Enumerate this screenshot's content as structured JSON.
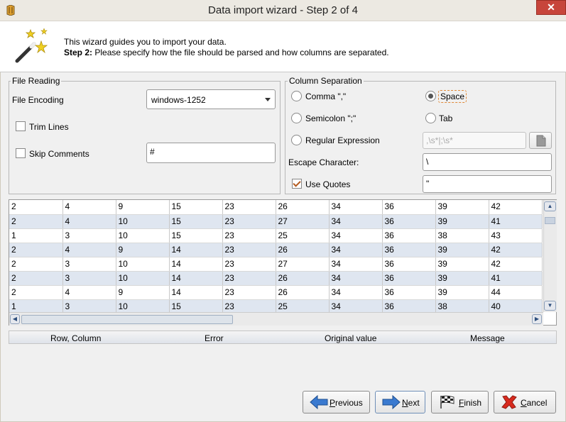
{
  "window": {
    "title": "Data import wizard - Step 2 of 4",
    "close_label": "✕"
  },
  "header": {
    "intro": "This wizard guides you to import your data.",
    "step_prefix": "Step 2:",
    "step_text": " Please specify how the file should be parsed and how columns are separated."
  },
  "file_reading": {
    "title": "File Reading",
    "encoding_label": "File Encoding",
    "encoding_value": "windows-1252",
    "trim_lines": {
      "label": "Trim Lines",
      "checked": false
    },
    "skip_comments": {
      "label": "Skip Comments",
      "checked": false
    },
    "comment_char": "#"
  },
  "column_separation": {
    "title": "Column Separation",
    "options": {
      "comma": "Comma \",\"",
      "space": "Space",
      "semicolon": "Semicolon \";\"",
      "tab": "Tab",
      "regex": "Regular Expression"
    },
    "selected": "space",
    "regex_value": ",\\s*|;\\s*",
    "escape_label": "Escape Character:",
    "escape_value": "\\",
    "use_quotes": {
      "label": "Use Quotes",
      "checked": true
    },
    "quote_value": "\""
  },
  "preview": {
    "rows": [
      [
        "2",
        "4",
        "9",
        "15",
        "23",
        "26",
        "34",
        "36",
        "39",
        "42"
      ],
      [
        "2",
        "4",
        "10",
        "15",
        "23",
        "27",
        "34",
        "36",
        "39",
        "41"
      ],
      [
        "1",
        "3",
        "10",
        "15",
        "23",
        "25",
        "34",
        "36",
        "38",
        "43"
      ],
      [
        "2",
        "4",
        "9",
        "14",
        "23",
        "26",
        "34",
        "36",
        "39",
        "42"
      ],
      [
        "2",
        "3",
        "10",
        "14",
        "23",
        "27",
        "34",
        "36",
        "39",
        "42"
      ],
      [
        "2",
        "3",
        "10",
        "14",
        "23",
        "26",
        "34",
        "36",
        "39",
        "41"
      ],
      [
        "2",
        "4",
        "9",
        "14",
        "23",
        "26",
        "34",
        "36",
        "39",
        "44"
      ],
      [
        "1",
        "3",
        "10",
        "15",
        "23",
        "25",
        "34",
        "36",
        "38",
        "40"
      ]
    ]
  },
  "errors": {
    "columns": [
      "Row, Column",
      "Error",
      "Original value",
      "Message"
    ]
  },
  "buttons": {
    "previous_u": "P",
    "previous_rest": "revious",
    "next_u": "N",
    "next_rest": "ext",
    "finish_u": "F",
    "finish_rest": "inish",
    "cancel_u": "C",
    "cancel_rest": "ancel"
  }
}
